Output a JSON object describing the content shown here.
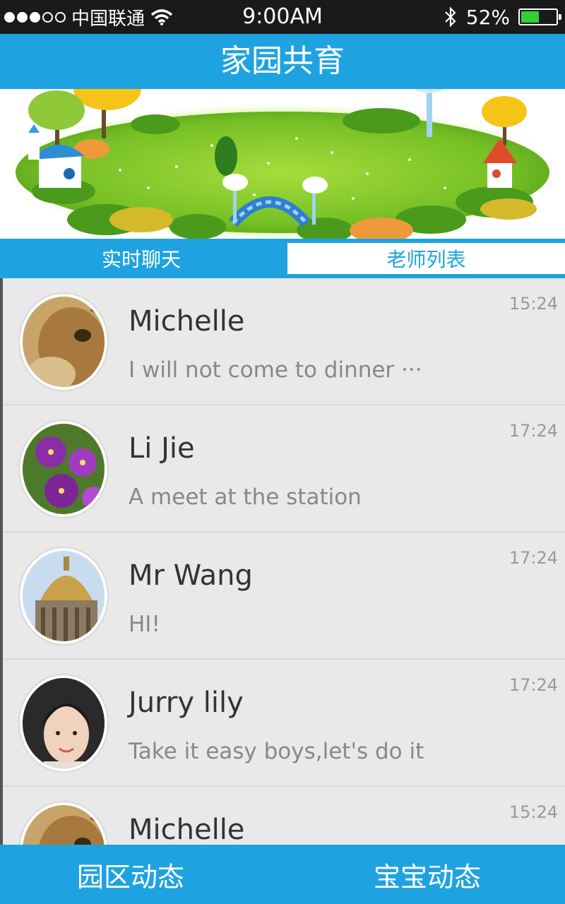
{
  "status_bar": {
    "carrier": "中国联通",
    "time": "9:00AM",
    "battery_percent": "52%",
    "battery_level": 0.52,
    "signal_bars_filled": 3,
    "signal_bars_total": 5,
    "icons": [
      "wifi-icon",
      "bluetooth-icon",
      "battery-icon"
    ]
  },
  "header": {
    "title": "家园共育"
  },
  "tabs": [
    {
      "label": "实时聊天",
      "active": false
    },
    {
      "label": "老师列表",
      "active": true
    }
  ],
  "chats": [
    {
      "name": "Michelle",
      "message": "I will not come to dinner ···",
      "time": "15:24",
      "avatar": "cat-photo"
    },
    {
      "name": "Li Jie",
      "message": "A meet at the station",
      "time": "17:24",
      "avatar": "purple-flowers-photo"
    },
    {
      "name": "Mr Wang",
      "message": "HI!",
      "time": "17:24",
      "avatar": "cathedral-dome-photo"
    },
    {
      "name": "Jurry lily",
      "message": "Take it easy boys,let's do it",
      "time": "17:24",
      "avatar": "woman-portrait-photo"
    },
    {
      "name": "Michelle",
      "message": "",
      "time": "15:24",
      "avatar": "cat-photo"
    }
  ],
  "bottom_nav": [
    {
      "label": "园区动态"
    },
    {
      "label": "宝宝动态"
    }
  ],
  "colors": {
    "primary": "#1fa3e0",
    "status_bar": "#1a1a1a",
    "list_bg": "#e9e9e9",
    "battery_fill": "#2fd02f"
  }
}
